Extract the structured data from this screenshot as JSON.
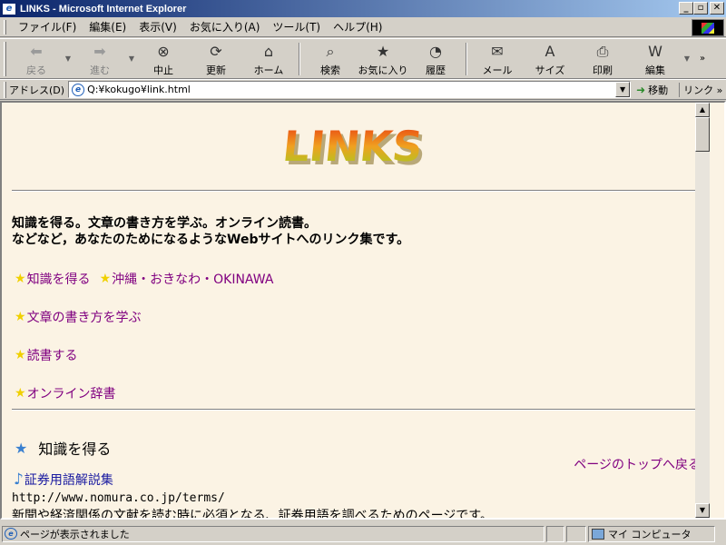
{
  "window": {
    "title": "LINKS - Microsoft Internet Explorer",
    "min": "_",
    "max": "▫",
    "close": "✕"
  },
  "menubar": {
    "items": [
      "ファイル(F)",
      "編集(E)",
      "表示(V)",
      "お気に入り(A)",
      "ツール(T)",
      "ヘルプ(H)"
    ]
  },
  "toolbar": {
    "back": "戻る",
    "forward": "進む",
    "stop": "中止",
    "refresh": "更新",
    "home": "ホーム",
    "search": "検索",
    "favorites": "お気に入り",
    "history": "履歴",
    "mail": "メール",
    "size": "サイズ",
    "print": "印刷",
    "edit": "編集",
    "more": "»"
  },
  "addressbar": {
    "label": "アドレス(D)",
    "url": "Q:¥kokugo¥link.html",
    "go": "移動",
    "links": "リンク »"
  },
  "page": {
    "logo_text": "LINKS",
    "intro_line1": "知識を得る。文章の書き方を学ぶ。オンライン読書。",
    "intro_line2": "などなど，あなたのためになるようなWebサイトへのリンク集です。",
    "links": [
      "知識を得る",
      "沖縄・おきなわ・OKINAWA",
      "文章の書き方を学ぶ",
      "読書する",
      "オンライン辞書"
    ],
    "section_title": "知識を得る",
    "top_link": "ページのトップへ戻る",
    "entry_title": "証券用語解説集",
    "entry_url": "http://www.nomura.co.jp/terms/",
    "entry_desc": "新聞や経済関係の文献を読む時に必須となる、証券用語を調べるためのページです。"
  },
  "statusbar": {
    "message": "ページが表示されました",
    "zone": "マイ コンピュータ"
  },
  "colors": {
    "page_bg": "#fbf3e4",
    "visited_link": "#800080",
    "star": "#f0d000"
  }
}
